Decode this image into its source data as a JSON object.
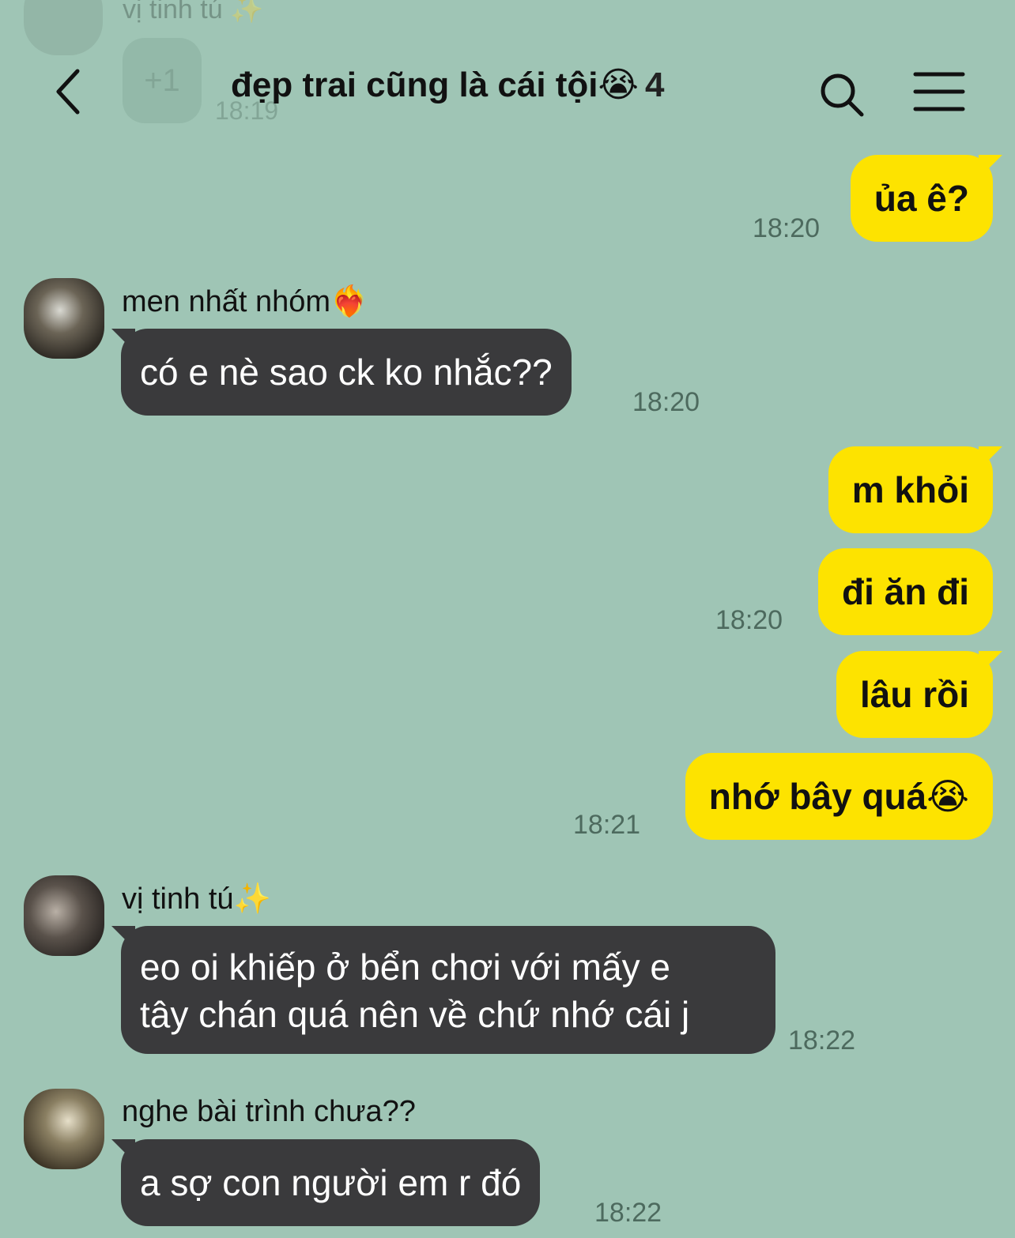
{
  "ghost": {
    "name": "vị tinh tú ✨",
    "bubble": "+1",
    "time": "18:19"
  },
  "header": {
    "title": "đẹp trai cũng là cái tội😭",
    "count": "4"
  },
  "messages": [
    {
      "text": "ủa ê?",
      "time": "18:20"
    },
    {
      "sender": "men nhất nhóm❤️‍🔥",
      "text": "có e nè sao ck ko nhắc??",
      "time": "18:20"
    },
    {
      "text": "m khỏi"
    },
    {
      "text": "đi ăn đi",
      "time": "18:20"
    },
    {
      "text": "lâu rồi"
    },
    {
      "text": "nhớ bây quá😭",
      "time": "18:21"
    },
    {
      "sender": "vị tinh tú✨",
      "line1": "eo oi khiếp ở bển chơi với mấy e",
      "line2": "tây chán quá nên về chứ nhớ cái j",
      "time": "18:22"
    },
    {
      "sender": "nghe bài trình chưa??",
      "text": "a sợ con người em r đó",
      "time": "18:22"
    }
  ]
}
